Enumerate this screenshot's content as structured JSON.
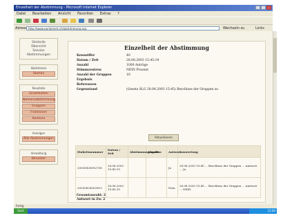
{
  "window": {
    "title": "Einzelheit der Abstimmung - Microsoft Internet Explorer",
    "menu": [
      "Datei",
      "Bearbeiten",
      "Ansicht",
      "Favoriten",
      "Extras",
      "?"
    ],
    "address_label": "Adresse",
    "address_value": "http://www.parlament.ch/abstimmung.asp",
    "go_label": "Wechseln zu",
    "links_label": "Links",
    "status_text": "Fertig",
    "start_label": "Start",
    "clock": "12:00"
  },
  "sidebar": {
    "panels": [
      {
        "heading": "Startseite",
        "links": [
          "Übersicht",
          "Session",
          "Abstimmungen"
        ]
      },
      {
        "heading": "Abstimmen",
        "buttons": [
          "Starten"
        ]
      },
      {
        "heading": "Resultate",
        "buttons": [
          "Einzelheiten",
          "Namensabstimmung",
          "Gruppen",
          "Fraktionen",
          "Kantone"
        ]
      },
      {
        "heading": "Anzeigen",
        "buttons": [
          "Alle Abstimmungen"
        ]
      },
      {
        "heading": "Verwaltung",
        "buttons": [
          "Benutzer"
        ]
      }
    ]
  },
  "main": {
    "title": "Einzelheit der Abstimmung",
    "fields": [
      {
        "label": "Kennziffer",
        "value": "40"
      },
      {
        "label": "Datum / Zeit",
        "value": "28.08.2003 15:45:19"
      },
      {
        "label": "Anzahl",
        "value": "1000 Anträge"
      },
      {
        "label": "Stimmzentren",
        "value": "NEIN Prozent"
      },
      {
        "label": "Anzahl der Gruppen",
        "value": "10"
      },
      {
        "label": "Ergebnis",
        "value": ""
      },
      {
        "label": "Referenzen",
        "value": ""
      },
      {
        "label": "Gegenstand",
        "value": "(Gesetz ÄLG 28.08.2003 15:45) Beschluss der Gruppen zu"
      }
    ],
    "action_button": "Aktualisieren",
    "table": {
      "headers": [
        "Einheitsnummer",
        "Datum / Zeit",
        "Abstimmungsmodus",
        "Abgabe",
        "Antwort",
        "Auswertung"
      ],
      "rows": [
        [
          "20030828092738",
          "28.08.2003 15:45:19",
          "",
          "",
          "Ja",
          "28.08.2003 15:45 ... Beschluss der Gruppen ... Antwort ... Ja"
        ],
        [
          "20030828092819",
          "28.08.2003 15:45:19",
          "",
          "",
          "Nein",
          "28.08.2003 15:45 ... Beschluss der Gruppen ... Antwort ... NEIN"
        ]
      ]
    },
    "footer": [
      "Gesamtanzahl: 2",
      "Antwort in Zu: 2"
    ]
  }
}
